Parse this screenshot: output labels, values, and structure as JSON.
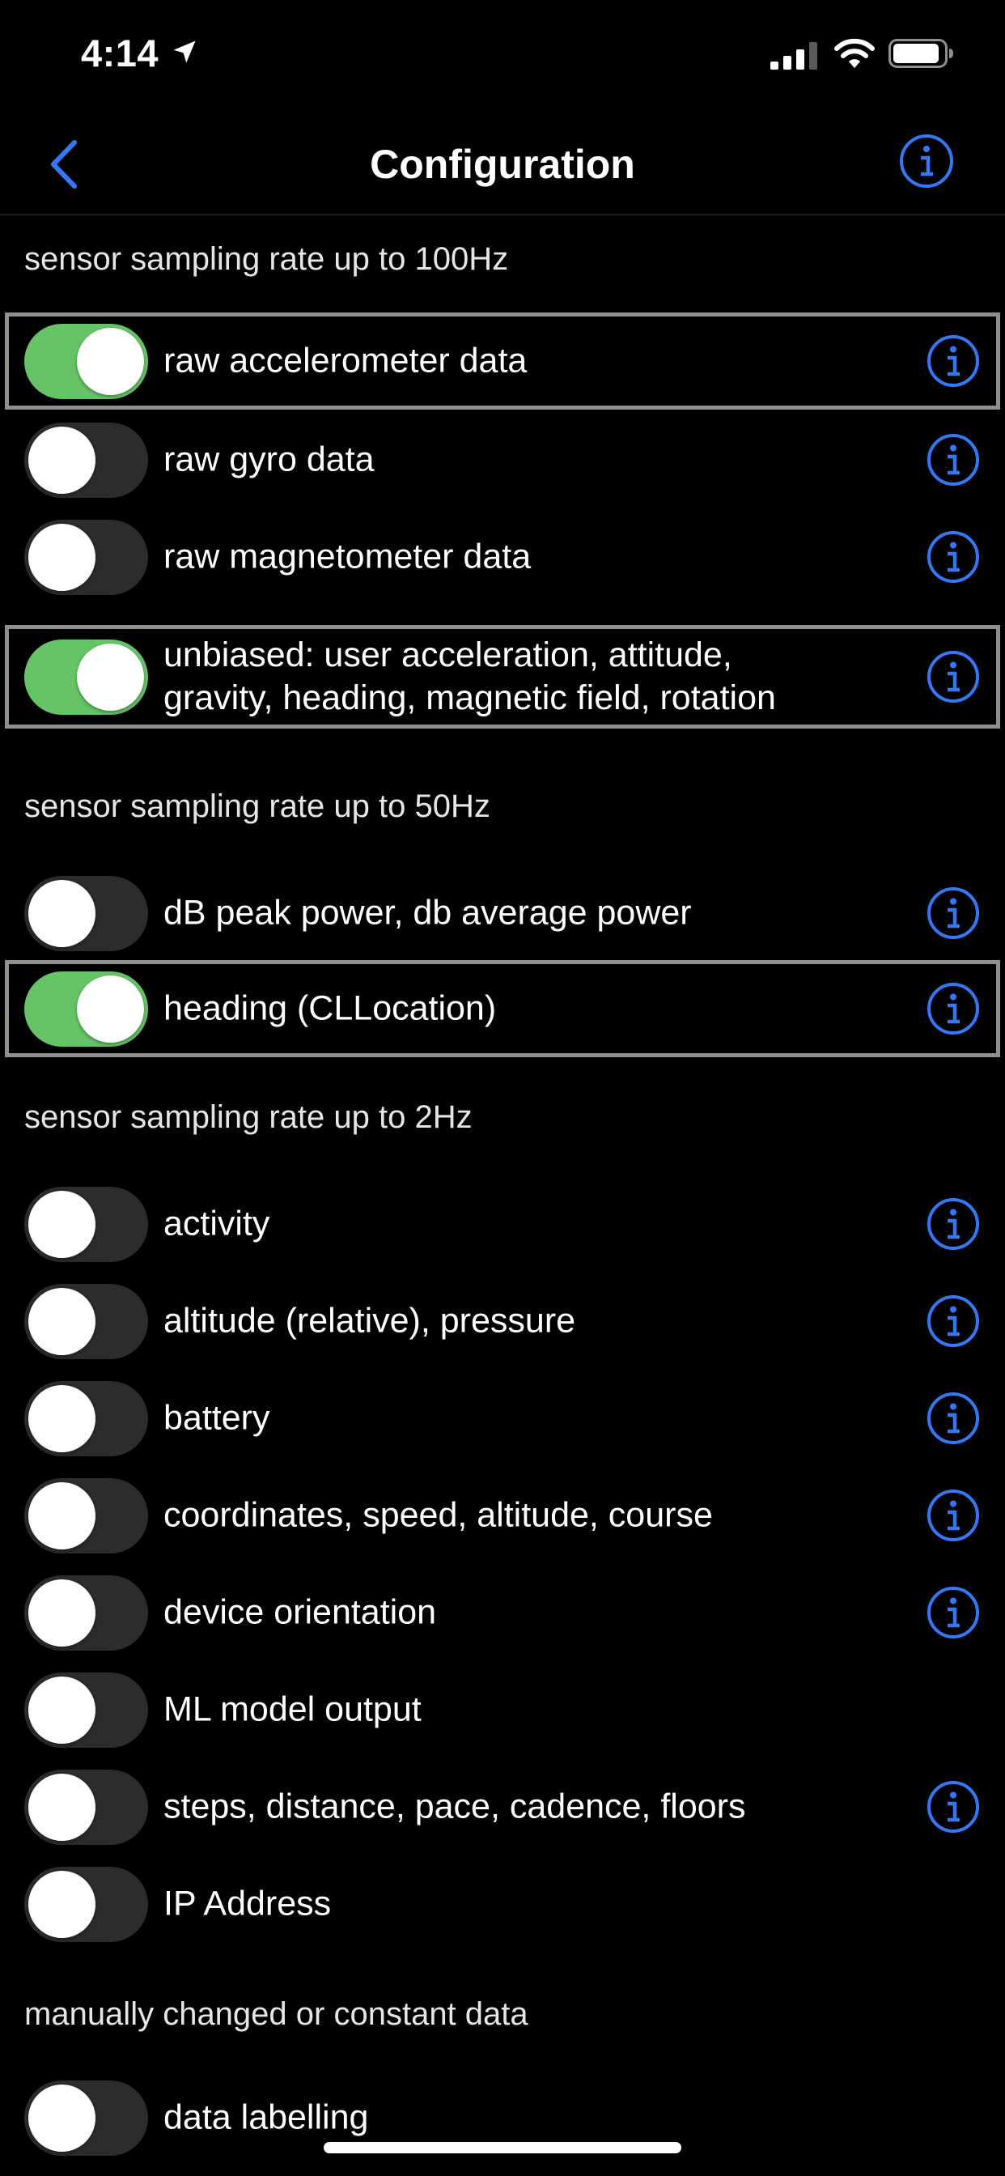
{
  "status_bar": {
    "time": "4:14",
    "location_icon": "location-arrow-icon",
    "signal_icon": "cellular-signal-icon",
    "wifi_icon": "wifi-icon",
    "battery_icon": "battery-icon"
  },
  "nav": {
    "title": "Configuration",
    "back_icon": "chevron-left-icon",
    "info_icon": "info-circle-icon"
  },
  "colors": {
    "accent": "#3478f6",
    "toggle_on": "#65c466",
    "toggle_off": "#2c2c2e",
    "background": "#000000"
  },
  "sections": [
    {
      "header": "sensor sampling rate up to 100Hz",
      "rows": [
        {
          "label": "raw accelerometer data",
          "on": true,
          "selected": true,
          "info": true
        },
        {
          "label": "raw gyro data",
          "on": false,
          "selected": false,
          "info": true
        },
        {
          "label": "raw magnetometer data",
          "on": false,
          "selected": false,
          "info": true
        },
        {
          "label": "unbiased: user acceleration, attitude,\ngravity, heading, magnetic field, rotation",
          "on": true,
          "selected": true,
          "info": true
        }
      ]
    },
    {
      "header": "sensor sampling rate up to 50Hz",
      "rows": [
        {
          "label": "dB peak power, db average power",
          "on": false,
          "selected": false,
          "info": true
        },
        {
          "label": "heading (CLLocation)",
          "on": true,
          "selected": true,
          "info": true
        }
      ]
    },
    {
      "header": "sensor sampling rate up to 2Hz",
      "rows": [
        {
          "label": "activity",
          "on": false,
          "selected": false,
          "info": true
        },
        {
          "label": "altitude (relative), pressure",
          "on": false,
          "selected": false,
          "info": true
        },
        {
          "label": "battery",
          "on": false,
          "selected": false,
          "info": true
        },
        {
          "label": "coordinates, speed, altitude, course",
          "on": false,
          "selected": false,
          "info": true
        },
        {
          "label": "device orientation",
          "on": false,
          "selected": false,
          "info": true
        },
        {
          "label": "ML model output",
          "on": false,
          "selected": false,
          "info": false
        },
        {
          "label": "steps, distance, pace, cadence, floors",
          "on": false,
          "selected": false,
          "info": true
        },
        {
          "label": "IP Address",
          "on": false,
          "selected": false,
          "info": false
        }
      ]
    },
    {
      "header": "manually changed or constant data",
      "rows": [
        {
          "label": "data labelling",
          "on": false,
          "selected": false,
          "info": false
        }
      ]
    }
  ]
}
